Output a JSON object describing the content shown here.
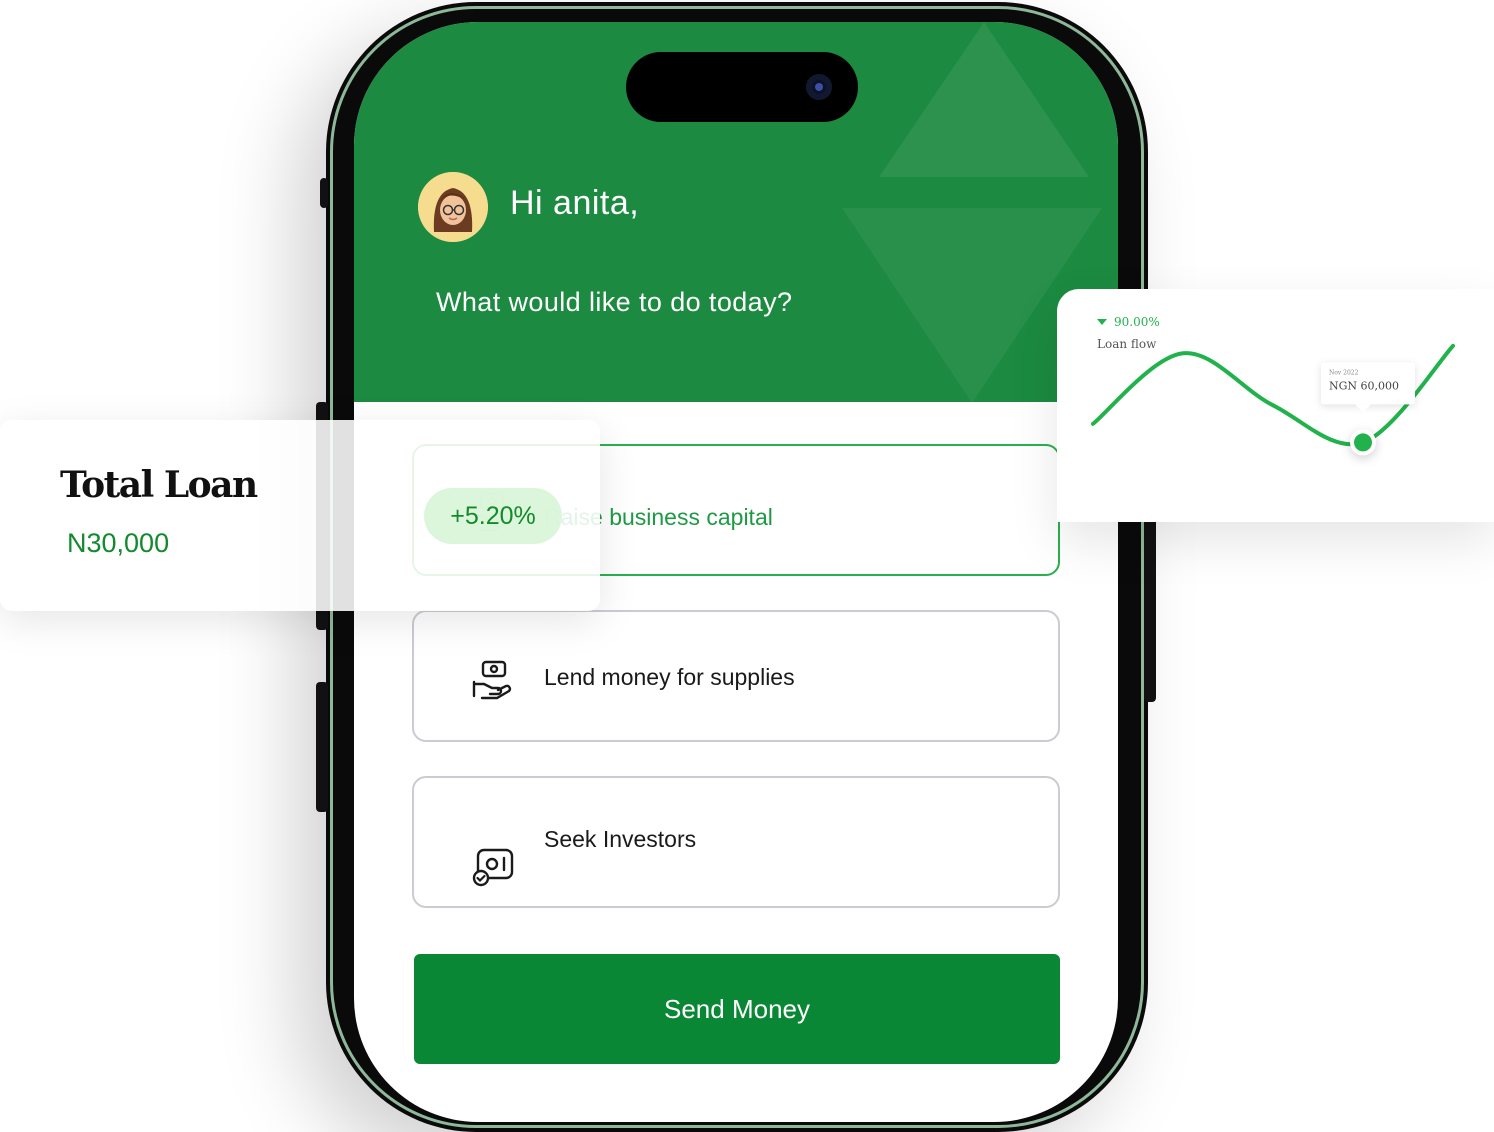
{
  "greeting": {
    "text": "Hi anita,"
  },
  "prompt": {
    "text": "What would like to do today?"
  },
  "options": [
    {
      "label": "Raise business capital",
      "icon": "cash-hand-icon"
    },
    {
      "label": "Lend money for supplies",
      "icon": "cash-hand-icon"
    },
    {
      "label": "Seek Investors",
      "icon": "investor-card-icon"
    }
  ],
  "actions": {
    "send_money": "Send Money"
  },
  "loan_card": {
    "title": "Total Loan",
    "amount": "N30,000",
    "change": "+5.20%"
  },
  "chart_data": {
    "type": "line",
    "change": "90.00%",
    "label": "Loan flow",
    "tooltip_date": "Nov 2022",
    "tooltip_value": "NGN 60,000",
    "trend": "down",
    "values": [
      10,
      48,
      20,
      0,
      52
    ],
    "highlight_index": 3,
    "ylim": [
      -10,
      60
    ]
  },
  "colors": {
    "header_green": "#1c8a40",
    "button_green": "#0a8734",
    "accent_green": "#2ab14f",
    "line_green": "#22b24c"
  }
}
